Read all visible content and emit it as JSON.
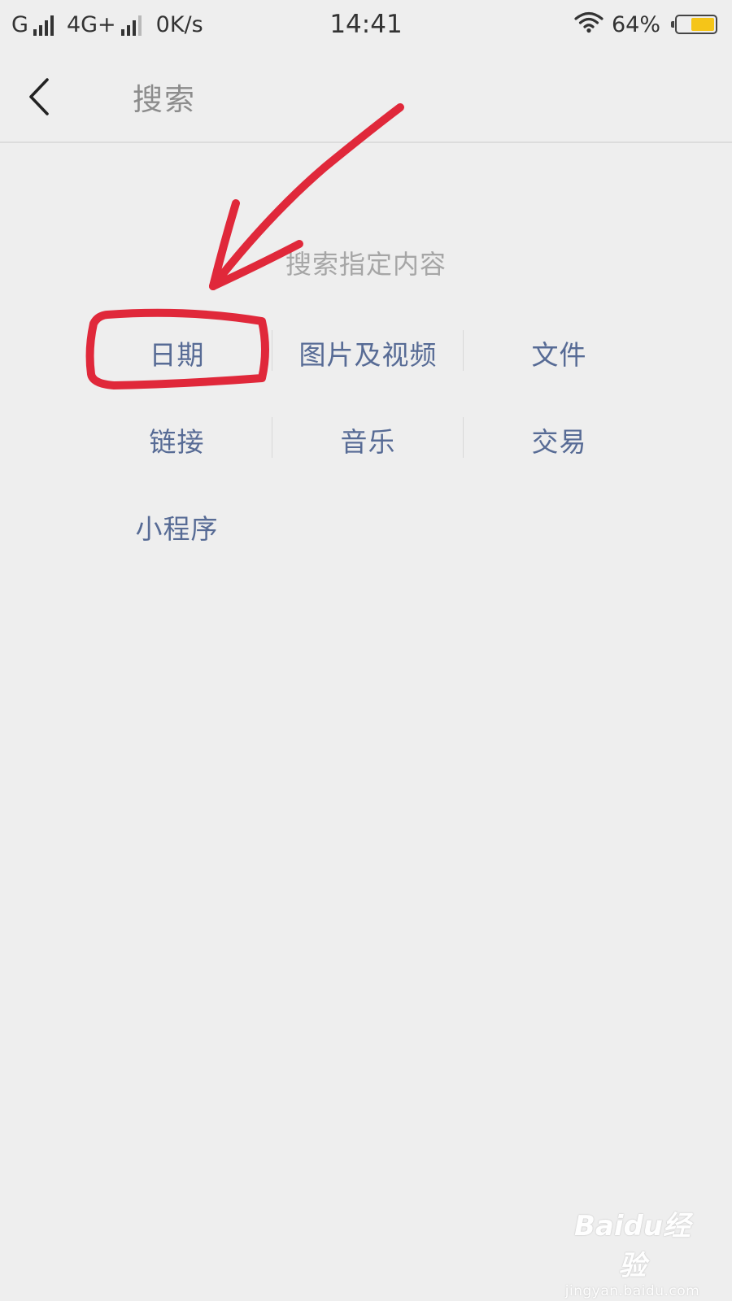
{
  "status_bar": {
    "carrier1": "G",
    "carrier2": "4G+",
    "speed": "0K/s",
    "time": "14:41",
    "battery_percent": "64%",
    "battery_level": 0.64,
    "battery_color": "#f5c518"
  },
  "nav": {
    "back_icon": "chevron-left-icon",
    "title": "搜索"
  },
  "main": {
    "section_title": "搜索指定内容",
    "rows": [
      [
        {
          "label": "日期"
        },
        {
          "label": "图片及视频"
        },
        {
          "label": "文件"
        }
      ],
      [
        {
          "label": "链接"
        },
        {
          "label": "音乐"
        },
        {
          "label": "交易"
        }
      ],
      [
        {
          "label": "小程序"
        }
      ]
    ],
    "link_color": "#576b95"
  },
  "annotation": {
    "color": "#e0283a",
    "highlighted_item": "日期"
  },
  "watermark": {
    "brand": "Baidu经验",
    "url": "jingyan.baidu.com"
  }
}
